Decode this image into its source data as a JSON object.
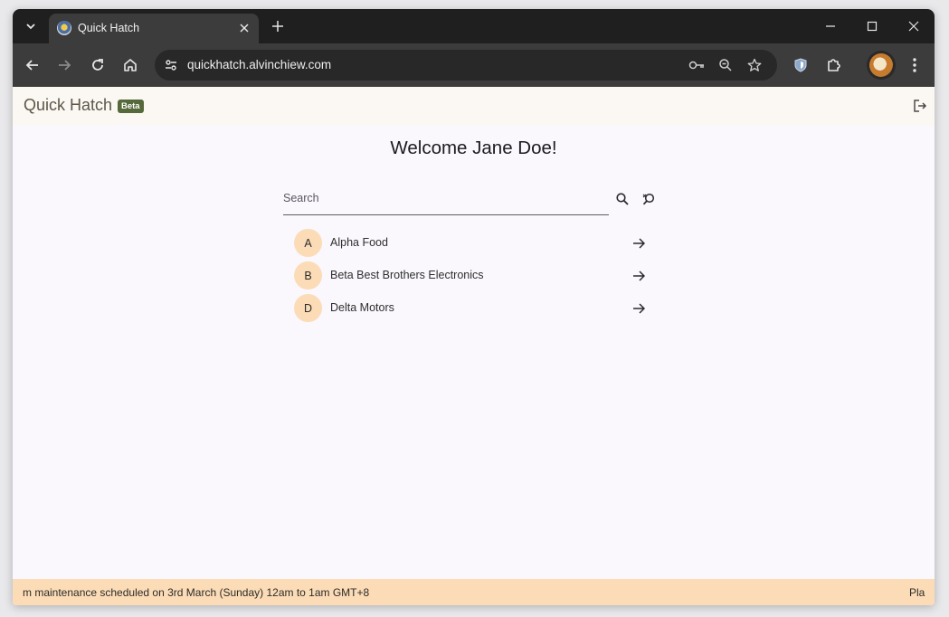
{
  "browser": {
    "tab_title": "Quick Hatch",
    "url": "quickhatch.alvinchiew.com"
  },
  "app": {
    "brand": "Quick Hatch",
    "badge": "Beta",
    "colors": {
      "badge_bg": "#55693a",
      "avatar_bg": "#fcdcb6",
      "banner_bg": "#fcdcb6"
    }
  },
  "main": {
    "welcome": "Welcome Jane Doe!",
    "search_placeholder": "Search",
    "search_value": "",
    "companies": [
      {
        "initial": "A",
        "name": "Alpha Food"
      },
      {
        "initial": "B",
        "name": "Beta Best Brothers Electronics"
      },
      {
        "initial": "D",
        "name": "Delta Motors"
      }
    ]
  },
  "banner": {
    "text": "m maintenance scheduled on 3rd March (Sunday) 12am to 1am GMT+8",
    "text_tail": "Pla"
  },
  "icons": {
    "tab_list": "chevron-down-icon",
    "tab_close": "close-icon",
    "new_tab": "plus-icon",
    "back": "arrow-left-icon",
    "forward": "arrow-right-icon",
    "reload": "reload-icon",
    "home": "home-icon",
    "site_info": "tune-icon",
    "passwords": "key-icon",
    "zoom": "zoom-icon",
    "bookmark": "star-icon",
    "extension_shield": "shield-icon",
    "extensions": "puzzle-icon",
    "menu": "kebab-icon",
    "logout": "logout-icon",
    "search": "search-icon",
    "clear_search": "search-off-icon",
    "open": "arrow-forward-icon"
  }
}
